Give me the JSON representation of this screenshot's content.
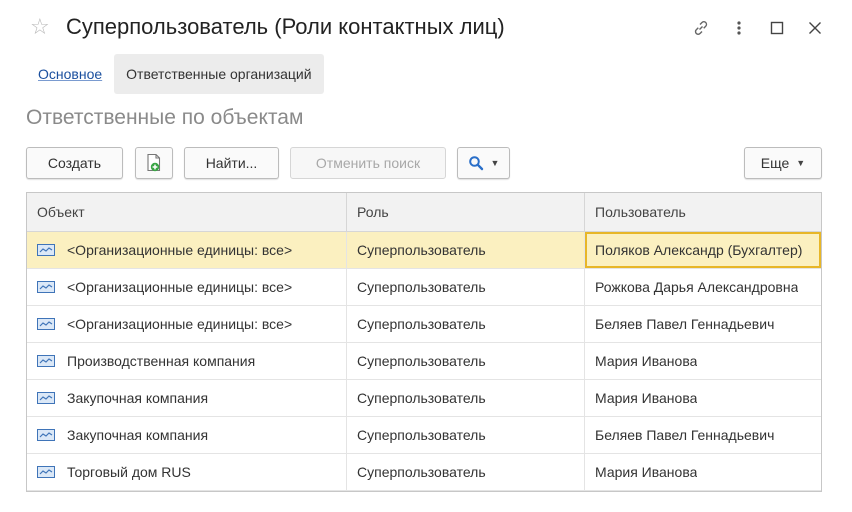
{
  "window": {
    "title": "Суперпользователь (Роли контактных лиц)"
  },
  "tabs": [
    {
      "label": "Основное"
    },
    {
      "label": "Ответственные организаций"
    }
  ],
  "section": {
    "title": "Ответственные по объектам"
  },
  "toolbar": {
    "create_label": "Создать",
    "find_label": "Найти...",
    "cancel_search_label": "Отменить поиск",
    "more_label": "Еще"
  },
  "table": {
    "columns": [
      "Объект",
      "Роль",
      "Пользователь"
    ],
    "rows": [
      {
        "object": "<Организационные единицы: все>",
        "role": "Суперпользователь",
        "user": "Поляков Александр (Бухгалтер)"
      },
      {
        "object": "<Организационные единицы: все>",
        "role": "Суперпользователь",
        "user": "Рожкова Дарья Александровна"
      },
      {
        "object": "<Организационные единицы: все>",
        "role": "Суперпользователь",
        "user": "Беляев Павел Геннадьевич"
      },
      {
        "object": "Производственная компания",
        "role": "Суперпользователь",
        "user": "Мария Иванова"
      },
      {
        "object": "Закупочная компания",
        "role": "Суперпользователь",
        "user": "Мария Иванова"
      },
      {
        "object": "Закупочная компания",
        "role": "Суперпользователь",
        "user": "Беляев Павел Геннадьевич"
      },
      {
        "object": "Торговый дом RUS",
        "role": "Суперпользователь",
        "user": "Мария Иванова"
      }
    ]
  },
  "colors": {
    "link": "#1a4f9e",
    "selected_row": "#fbf0c0",
    "focus_border": "#e7b628"
  }
}
